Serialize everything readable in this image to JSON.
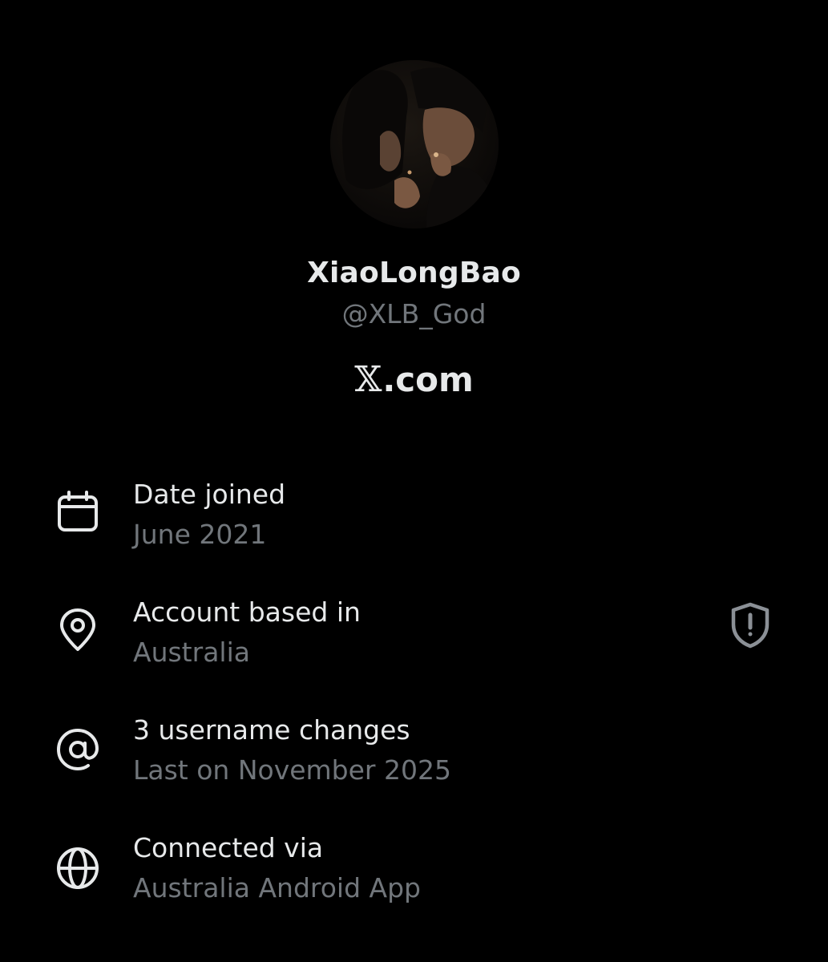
{
  "profile": {
    "display_name": "XiaoLongBao",
    "handle": "@XLB_God",
    "site_glyph": "𝕏",
    "site_suffix": ".com"
  },
  "rows": [
    {
      "title": "Date joined",
      "value": "June 2021",
      "icon": "calendar-icon"
    },
    {
      "title": "Account based in",
      "value": "Australia",
      "icon": "location-pin-icon",
      "extra_icon": "shield-exclamation-icon"
    },
    {
      "title": "3 username changes",
      "value": "Last on November 2025",
      "icon": "at-sign-icon"
    },
    {
      "title": "Connected via",
      "value": "Australia Android App",
      "icon": "globe-icon"
    }
  ],
  "colors": {
    "background": "#000000",
    "primary_text": "#e7e9ea",
    "secondary_text": "#71767b"
  }
}
